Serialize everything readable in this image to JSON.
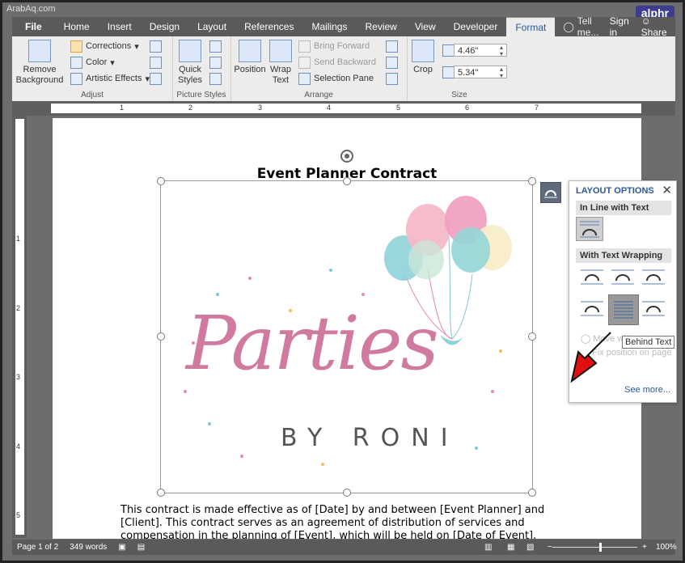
{
  "watermark": "ArabAq.com",
  "brand": "alphr",
  "tabs": [
    "File",
    "Home",
    "Insert",
    "Design",
    "Layout",
    "References",
    "Mailings",
    "Review",
    "View",
    "Developer",
    "Format"
  ],
  "active_tab": "Format",
  "tell_me": "Tell me...",
  "sign_in": "Sign in",
  "share": "Share",
  "ribbon": {
    "remove_bg": "Remove Background",
    "corrections": "Corrections",
    "color": "Color",
    "artistic": "Artistic Effects",
    "adjust": "Adjust",
    "quick_styles": "Quick Styles",
    "picture_styles": "Picture Styles",
    "position": "Position",
    "wrap_text": "Wrap Text",
    "bring_forward": "Bring Forward",
    "send_backward": "Send Backward",
    "selection_pane": "Selection Pane",
    "arrange": "Arrange",
    "crop": "Crop",
    "height": "4.46\"",
    "width": "5.34\"",
    "size": "Size"
  },
  "ruler_numbers": [
    "1",
    "2",
    "3",
    "4",
    "5",
    "6",
    "7"
  ],
  "vruler_numbers": [
    "1",
    "2",
    "3",
    "4",
    "5"
  ],
  "doc": {
    "title": "Event Planner Contract",
    "body": "This contract is made effective as of [Date] by and between [Event Planner] and [Client]. This contract serves as an agreement of distribution of services and compensation in the planning of [Event], which will be held on [Date of Event].",
    "logo_script": "Parties",
    "logo_sub": "BY RONI"
  },
  "layout_options": {
    "title": "LAYOUT OPTIONS",
    "inline": "In Line with Text",
    "wrapping": "With Text Wrapping",
    "tooltip": "Behind Text",
    "move_with": "Move with text",
    "fix_position": "Fix position on page",
    "see_more": "See more..."
  },
  "status": {
    "page": "Page 1 of 2",
    "words": "349 words",
    "zoom": "100%"
  }
}
